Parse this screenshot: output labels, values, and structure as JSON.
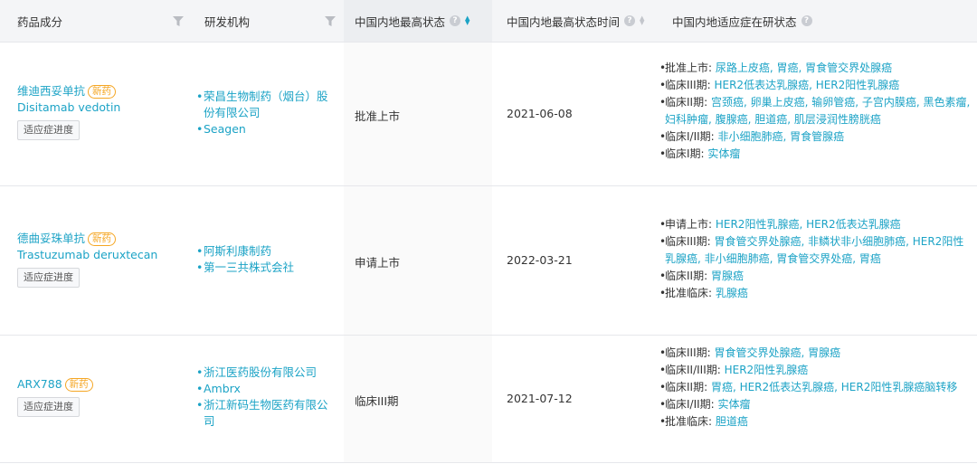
{
  "header": {
    "col_drug": "药品成分",
    "col_org": "研发机构",
    "col_status": "中国内地最高状态",
    "col_time": "中国内地最高状态时间",
    "col_indication": "中国内地适应症在研状态",
    "help_glyph": "?"
  },
  "badge_new": "新药",
  "progress_button": "适应症进度",
  "bullet": "•",
  "rows": [
    {
      "drug_cn": "维迪西妥单抗",
      "drug_en": "Disitamab vedotin",
      "orgs": [
        "荣昌生物制药（烟台）股份有限公司",
        "Seagen"
      ],
      "status": "批准上市",
      "date": "2021-06-08",
      "indications": [
        {
          "label": "批准上市: ",
          "value": "尿路上皮癌, 胃癌, 胃食管交界处腺癌"
        },
        {
          "label": "临床III期: ",
          "value": "HER2低表达乳腺癌, HER2阳性乳腺癌"
        },
        {
          "label": "临床II期: ",
          "value": "宫颈癌, 卵巢上皮癌, 输卵管癌, 子宫内膜癌, 黑色素瘤, 妇科肿瘤, 腹腺癌, 胆道癌, 肌层浸润性膀胱癌"
        },
        {
          "label": "临床I/II期: ",
          "value": "非小细胞肺癌, 胃食管腺癌"
        },
        {
          "label": "临床I期: ",
          "value": "实体瘤"
        }
      ]
    },
    {
      "drug_cn": "德曲妥珠单抗",
      "drug_en": "Trastuzumab deruxtecan",
      "orgs": [
        "阿斯利康制药",
        "第一三共株式会社"
      ],
      "status": "申请上市",
      "date": "2022-03-21",
      "indications": [
        {
          "label": "申请上市: ",
          "value": "HER2阳性乳腺癌, HER2低表达乳腺癌"
        },
        {
          "label": "临床III期: ",
          "value": "胃食管交界处腺癌, 非鳞状非小细胞肺癌, HER2阳性乳腺癌, 非小细胞肺癌, 胃食管交界处癌, 胃癌"
        },
        {
          "label": "临床II期: ",
          "value": "胃腺癌"
        },
        {
          "label": "批准临床: ",
          "value": "乳腺癌"
        }
      ]
    },
    {
      "drug_cn": "ARX788",
      "drug_en": "",
      "orgs": [
        "浙江医药股份有限公司",
        "Ambrx",
        "浙江新码生物医药有限公司"
      ],
      "status": "临床III期",
      "date": "2021-07-12",
      "indications": [
        {
          "label": "临床III期: ",
          "value": "胃食管交界处腺癌, 胃腺癌"
        },
        {
          "label": "临床II/III期: ",
          "value": "HER2阳性乳腺癌"
        },
        {
          "label": "临床II期: ",
          "value": "胃癌, HER2低表达乳腺癌, HER2阳性乳腺癌脑转移"
        },
        {
          "label": "临床I/II期: ",
          "value": "实体瘤"
        },
        {
          "label": "批准临床: ",
          "value": "胆道癌"
        }
      ]
    }
  ]
}
